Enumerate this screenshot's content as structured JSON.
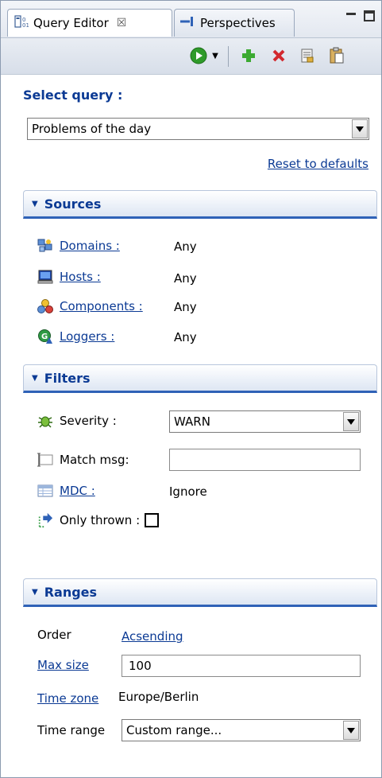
{
  "tabs": {
    "query_editor": "Query Editor",
    "query_editor_close": "☒",
    "perspectives": "Perspectives"
  },
  "icons": {
    "query_editor_tab": "query-table-icon",
    "perspectives_tab": "perspective-arrow-icon",
    "run": "run-play-icon",
    "add": "add-plus-icon",
    "delete": "delete-x-icon",
    "save": "save-document-icon",
    "paste": "clipboard-icon",
    "domains": "domains-icon",
    "hosts": "host-monitor-icon",
    "components": "components-icon",
    "loggers": "logger-icon",
    "severity": "severity-bug-icon",
    "match_msg": "text-field-icon",
    "mdc": "table-icon",
    "only_thrown": "thrown-arrow-icon"
  },
  "colors": {
    "accent": "#0b3a94",
    "section_underline": "#2f62b7",
    "run_green": "#2f9b2a",
    "add_green": "#3caa32",
    "delete_red": "#d2282e"
  },
  "query": {
    "label": "Select query :",
    "selected": "Problems of the day",
    "reset_link": "Reset to defaults"
  },
  "sources": {
    "title": "Sources",
    "rows": [
      {
        "label": "Domains :",
        "value": "Any"
      },
      {
        "label": "Hosts :",
        "value": "Any"
      },
      {
        "label": "Components :",
        "value": "Any"
      },
      {
        "label": "Loggers :",
        "value": "Any"
      }
    ]
  },
  "filters": {
    "title": "Filters",
    "severity_label": "Severity :",
    "severity_value": "WARN",
    "match_msg_label": "Match msg:",
    "match_msg_value": "",
    "mdc_label": "MDC :",
    "mdc_value": "Ignore",
    "only_thrown_label": "Only thrown :",
    "only_thrown_checked": false
  },
  "ranges": {
    "title": "Ranges",
    "order_label": "Order",
    "order_value": "Acsending",
    "max_size_label": "Max size",
    "max_size_value": "100",
    "time_zone_label": "Time zone",
    "time_zone_value": "Europe/Berlin",
    "time_range_label": "Time range",
    "time_range_value": "Custom range..."
  }
}
